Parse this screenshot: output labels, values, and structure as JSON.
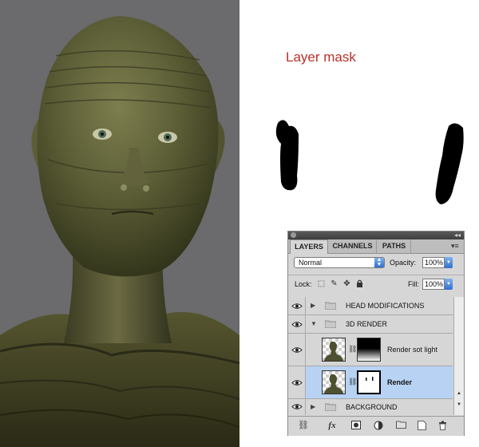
{
  "caption": "Layer mask",
  "colors": {
    "caption": "#b8302a",
    "selection": "#b7d2f3",
    "accent_blue": "#2f6fd0"
  },
  "panel": {
    "tabs": [
      {
        "label": "LAYERS",
        "active": true
      },
      {
        "label": "CHANNELS",
        "active": false
      },
      {
        "label": "PATHS",
        "active": false
      }
    ],
    "blend_mode": "Normal",
    "opacity_label": "Opacity:",
    "opacity_value": "100%",
    "lock_label": "Lock:",
    "fill_label": "Fill:",
    "fill_value": "100%",
    "layers": [
      {
        "name": "HEAD MODIFICATIONS",
        "type": "group",
        "expanded": false,
        "visible": true
      },
      {
        "name": "3D RENDER",
        "type": "group",
        "expanded": true,
        "visible": true
      },
      {
        "name": "Render sot light",
        "type": "layer",
        "has_mask": true,
        "visible": true,
        "selected": false
      },
      {
        "name": "Render",
        "type": "layer",
        "has_mask": true,
        "visible": true,
        "selected": true
      },
      {
        "name": "BACKGROUND",
        "type": "group",
        "expanded": false,
        "visible": true
      }
    ],
    "icons": {
      "lock": [
        "lock-transparent-icon",
        "lock-pixels-icon",
        "lock-position-icon",
        "lock-all-icon"
      ],
      "bottom": [
        "link-layers-icon",
        "fx-icon",
        "add-mask-icon",
        "adjustment-layer-icon",
        "new-group-icon",
        "new-layer-icon",
        "trash-icon"
      ]
    }
  }
}
